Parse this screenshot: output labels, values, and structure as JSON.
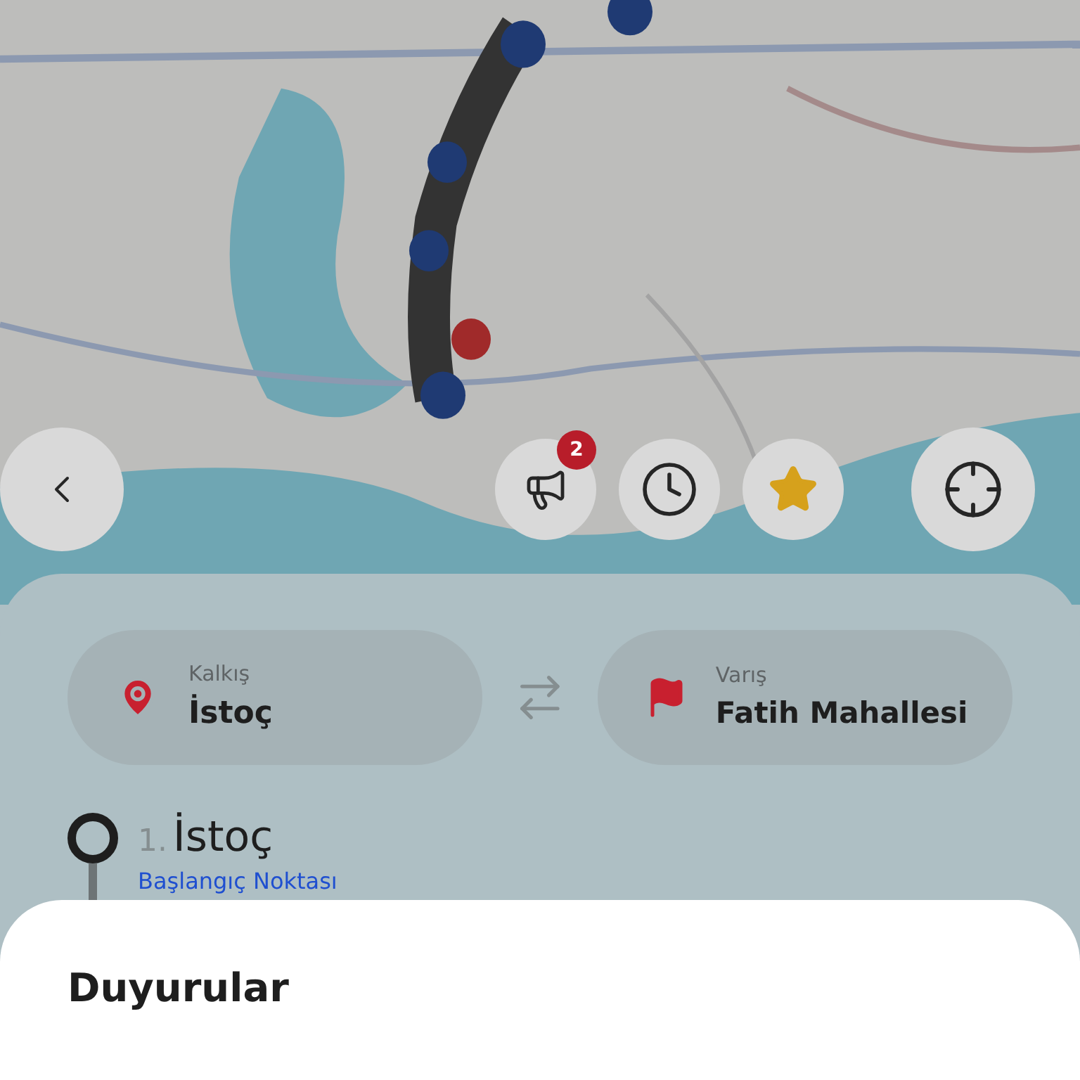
{
  "map_buttons": [
    {
      "kind": "back"
    },
    {
      "kind": "announcements",
      "badge": "2"
    },
    {
      "kind": "history"
    },
    {
      "kind": "favorites"
    },
    {
      "kind": "locate"
    }
  ],
  "route": {
    "origin": {
      "label": "Kalkış",
      "value": "İstoç"
    },
    "destination": {
      "label": "Varış",
      "value": "Fatih Mahallesi"
    }
  },
  "stops": [
    {
      "number": "1.",
      "name": "İstoç",
      "subtitle": "Başlangıç Noktası"
    }
  ],
  "sheet": {
    "title": "Duyurular"
  }
}
